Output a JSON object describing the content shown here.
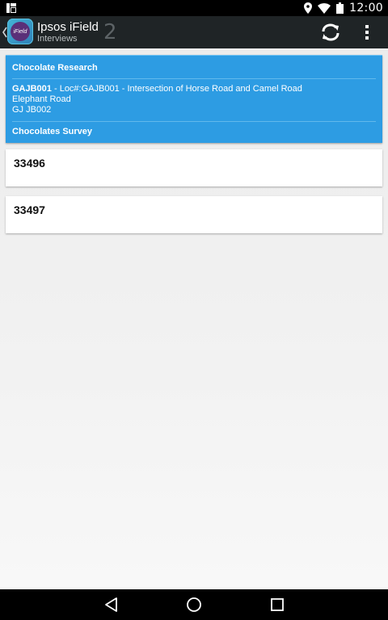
{
  "status_bar": {
    "time": "12:00",
    "icons": [
      "notification-icon",
      "location-icon",
      "wifi-icon",
      "battery-icon"
    ]
  },
  "action_bar": {
    "title": "Ipsos iField",
    "subtitle": "Interviews",
    "count": "2",
    "app_icon_text": "iField",
    "actions": [
      "sync-icon",
      "overflow-menu-icon"
    ]
  },
  "header": {
    "project": "Chocolate Research",
    "location_code": "GAJB001",
    "location_detail": " - Loc#:GAJB001 - Intersection of Horse Road and Camel Road",
    "address_line": "Elephant Road",
    "area_code": "GJ JB002",
    "survey": "Chocolates Survey"
  },
  "interviews": [
    {
      "id": "33496"
    },
    {
      "id": "33497"
    }
  ],
  "nav_bar": {
    "buttons": [
      "back-icon",
      "home-icon",
      "recents-icon"
    ]
  },
  "colors": {
    "header_card": "#2d9ce3",
    "action_bar": "#1f2426",
    "background": "#ececec"
  }
}
